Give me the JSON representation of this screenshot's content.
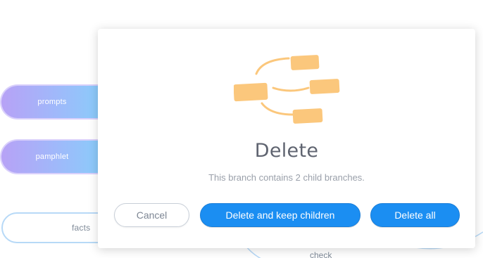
{
  "background": {
    "nodes": [
      {
        "label": "prompts"
      },
      {
        "label": "pamphlet"
      },
      {
        "label": "facts"
      },
      {
        "label": "check"
      }
    ]
  },
  "dialog": {
    "title": "Delete",
    "message": "This branch contains 2 child branches.",
    "illustration": "branch-tree-icon",
    "buttons": {
      "cancel": "Cancel",
      "keep_children": "Delete and keep children",
      "delete_all": "Delete all"
    }
  },
  "colors": {
    "primary": "#1b8ef2",
    "illustration": "#fbc77c",
    "node_gradient_start": "#b7a2f6",
    "node_gradient_end": "#84d2fb",
    "node_outline": "#b7d9f7"
  }
}
